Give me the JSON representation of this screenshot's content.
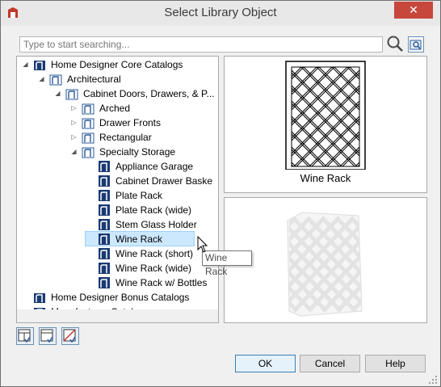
{
  "window": {
    "title": "Select Library Object",
    "close_label": "✕"
  },
  "search": {
    "placeholder": "Type to start searching..."
  },
  "tree": {
    "items": [
      {
        "label": "Home Designer Core Catalogs",
        "icon": "catalog-icon",
        "expanded": true
      },
      {
        "label": "Architectural",
        "icon": "folder-icon",
        "expanded": true
      },
      {
        "label": "Cabinet Doors, Drawers, & P...",
        "icon": "folder-icon",
        "expanded": true
      },
      {
        "label": "Arched",
        "icon": "folder-icon",
        "expanded": false
      },
      {
        "label": "Drawer Fronts",
        "icon": "folder-icon",
        "expanded": false
      },
      {
        "label": "Rectangular",
        "icon": "folder-icon",
        "expanded": false
      },
      {
        "label": "Specialty Storage",
        "icon": "folder-icon",
        "expanded": true
      },
      {
        "label": "Appliance Garage",
        "icon": "object-icon"
      },
      {
        "label": "Cabinet Drawer Baske",
        "icon": "object-icon"
      },
      {
        "label": "Plate Rack",
        "icon": "object-icon"
      },
      {
        "label": "Plate Rack (wide)",
        "icon": "object-icon"
      },
      {
        "label": "Stem Glass Holder",
        "icon": "object-icon"
      },
      {
        "label": "Wine Rack",
        "icon": "object-icon",
        "selected": true
      },
      {
        "label": "Wine Rack (short)",
        "icon": "object-icon"
      },
      {
        "label": "Wine Rack (wide)",
        "icon": "object-icon"
      },
      {
        "label": "Wine Rack w/ Bottles",
        "icon": "object-icon"
      },
      {
        "label": "Home Designer Bonus Catalogs",
        "icon": "catalog-icon"
      },
      {
        "label": "Manufacturer Catalogs",
        "icon": "catalog-icon"
      }
    ]
  },
  "preview": {
    "caption": "Wine Rack"
  },
  "tooltip": {
    "text": "Wine Rack"
  },
  "buttons": {
    "ok": "OK",
    "cancel": "Cancel",
    "help": "Help"
  },
  "colors": {
    "catalog_icon": "#1a3a73",
    "selection": "#cce8ff",
    "close_button": "#c7473d"
  }
}
